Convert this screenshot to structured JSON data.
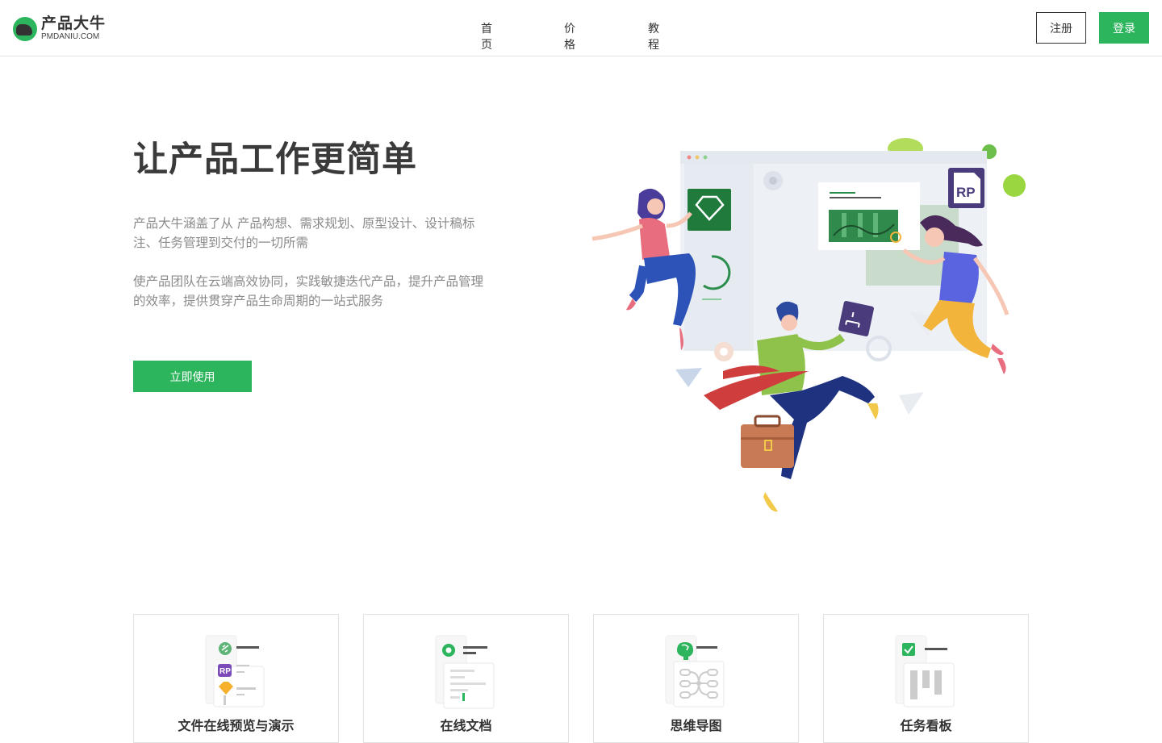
{
  "header": {
    "logo_cn": "产品大牛",
    "logo_en": "PMDANIU.COM",
    "nav": [
      "首页",
      "价格",
      "教程"
    ],
    "register_label": "注册",
    "login_label": "登录"
  },
  "hero": {
    "title": "让产品工作更简单",
    "desc1": "产品大牛涵盖了从 产品构想、需求规划、原型设计、设计稿标注、任务管理到交付的一切所需",
    "desc2": "使产品团队在云端高效协同，实践敏捷迭代产品，提升产品管理的效率，提供贯穿产品生命周期的一站式服务",
    "cta_label": "立即使用",
    "rp_badge": "RP"
  },
  "features": [
    {
      "label": "文件在线预览与演示",
      "icon": "file-preview-icon",
      "badge": "RP"
    },
    {
      "label": "在线文档",
      "icon": "document-icon"
    },
    {
      "label": "思维导图",
      "icon": "mindmap-icon"
    },
    {
      "label": "任务看板",
      "icon": "kanban-icon"
    }
  ],
  "colors": {
    "brand": "#2db55d",
    "text": "#333333",
    "muted": "#8a8a8a",
    "border": "#e2e2e2"
  }
}
